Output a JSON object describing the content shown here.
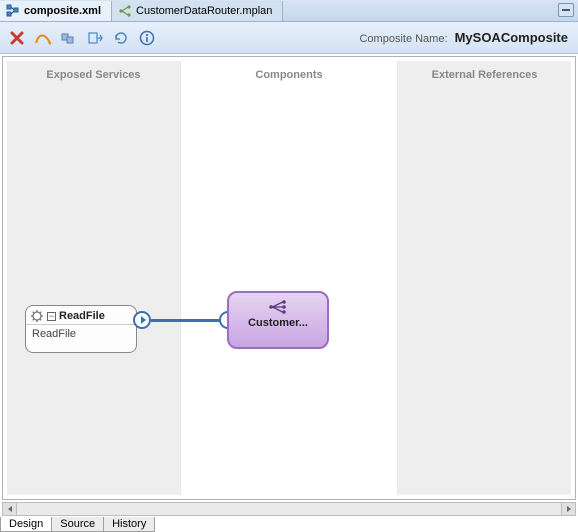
{
  "tabs": {
    "composite": {
      "label": "composite.xml",
      "icon": "composite-icon"
    },
    "mplan": {
      "label": "CustomerDataRouter.mplan",
      "icon": "mplan-icon"
    }
  },
  "toolbar": {
    "composite_label": "Composite Name:",
    "composite_name": "MySOAComposite"
  },
  "lanes": {
    "exposed": "Exposed Services",
    "components": "Components",
    "external": "External References"
  },
  "nodes": {
    "readfile": {
      "title": "ReadFile",
      "subtitle": "ReadFile",
      "expand_glyph": "−"
    },
    "customer": {
      "title": "Customer..."
    }
  },
  "bottom_tabs": {
    "design": "Design",
    "source": "Source",
    "history": "History"
  }
}
